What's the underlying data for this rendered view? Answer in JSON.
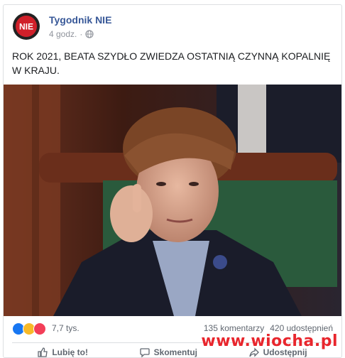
{
  "post": {
    "page_name": "Tygodnik NIE",
    "time_ago": "4 godz.",
    "privacy_icon": "globe-icon",
    "text": "ROK 2021, BEATA SZYDŁO ZWIEDZA OSTATNIĄ CZYNNĄ KOPALNIĘ W KRAJU."
  },
  "avatar": {
    "logo_text": "NIE",
    "color": "#d0202a"
  },
  "reactions": {
    "types": [
      "like-icon",
      "haha-icon",
      "love-icon"
    ],
    "count": "7,7 tys.",
    "comments": "135 komentarzy",
    "shares": "420 udostępnień"
  },
  "actions": [
    {
      "label": "Lubię to!",
      "icon": "thumbs-up-icon"
    },
    {
      "label": "Skomentuj",
      "icon": "comment-icon"
    },
    {
      "label": "Udostępnij",
      "icon": "share-icon"
    }
  ],
  "watermark": "www.wiocha.pl",
  "colors": {
    "link": "#385898",
    "meta": "#90949c",
    "accent": "#e8262d"
  }
}
